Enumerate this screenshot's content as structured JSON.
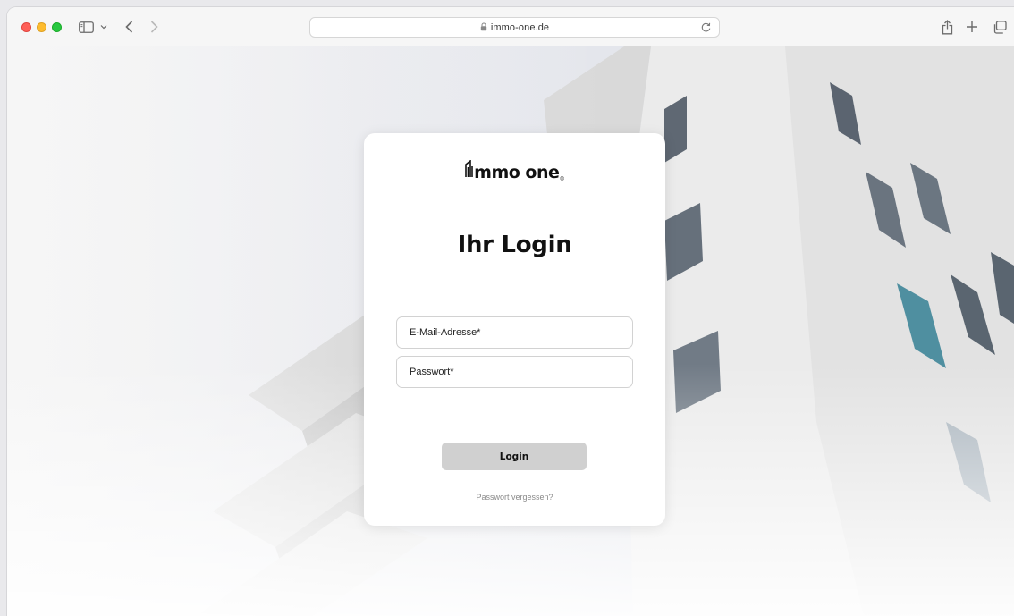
{
  "browser": {
    "url": "immo-one.de",
    "icons": {
      "sidebar": "sidebar-icon",
      "chevron": "chevron-down-icon",
      "back": "chevron-left-icon",
      "forward": "chevron-right-icon",
      "lock": "lock-icon",
      "reload": "reload-icon",
      "share": "share-icon",
      "new_tab": "plus-icon",
      "tabs": "tabs-overview-icon"
    }
  },
  "login": {
    "logo_text": "mmo one",
    "title": "Ihr Login",
    "email_placeholder": "E-Mail-Adresse*",
    "password_placeholder": "Passwort*",
    "submit_label": "Login",
    "forgot_link": "Passwort vergessen?"
  },
  "colors": {
    "button_bg": "#d0d0d0",
    "traffic_red": "#fe5f57",
    "traffic_yellow": "#febc2e",
    "traffic_green": "#28c840"
  }
}
